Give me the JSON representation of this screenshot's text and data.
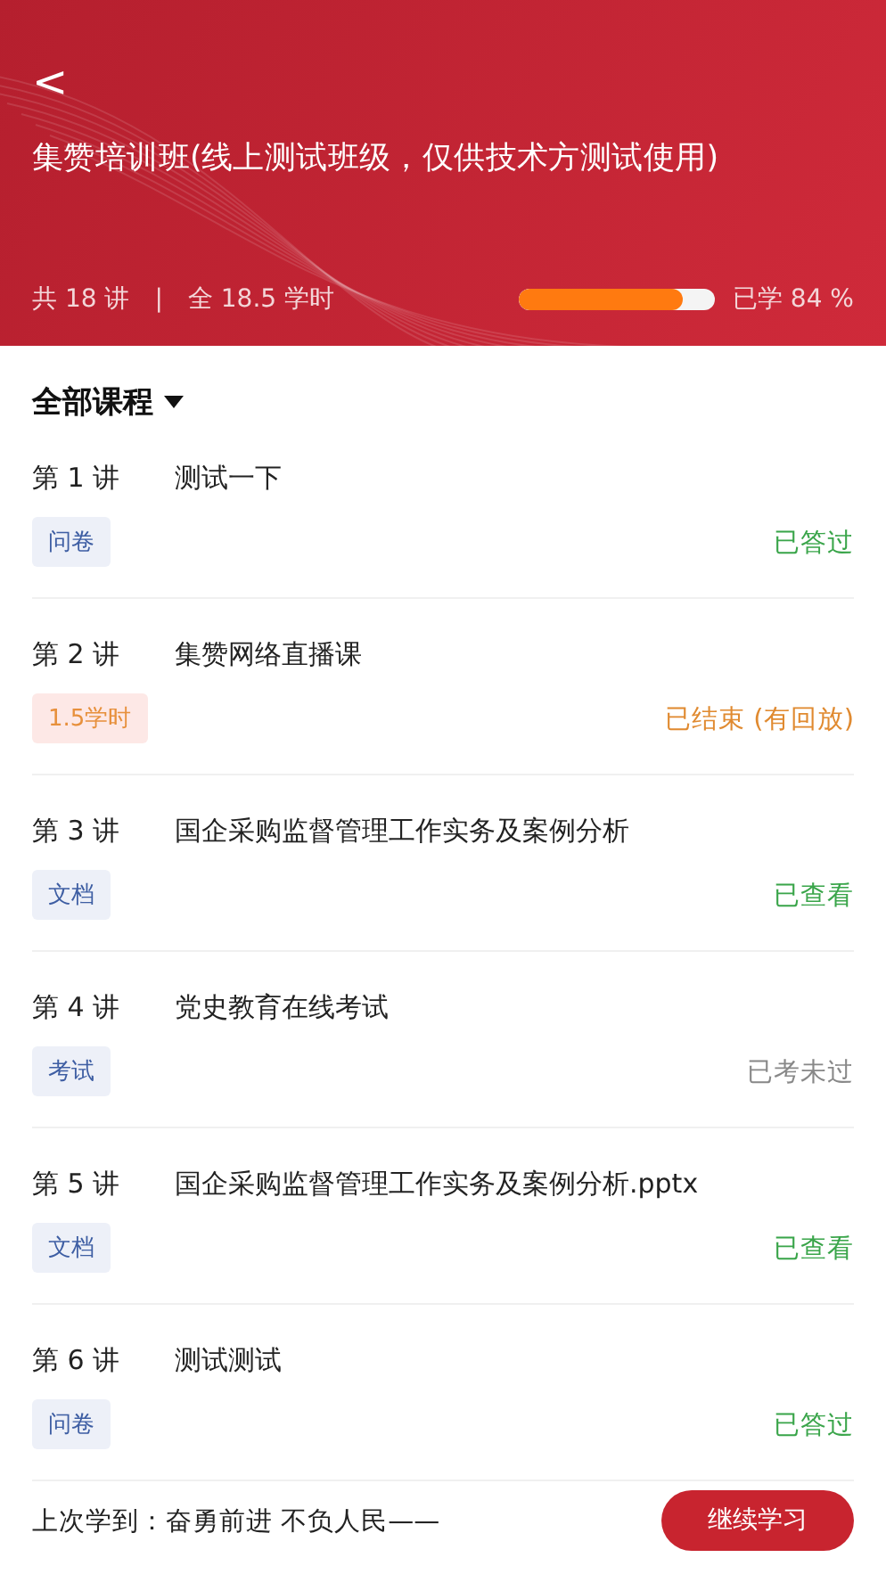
{
  "header": {
    "back": "<",
    "title": "集赞培训班(线上测试班级，仅供技术方测试使用)",
    "lectures": "共 18 讲",
    "separator": "|",
    "hours": "全 18.5 学时",
    "progress": {
      "level": 0.84,
      "label": "已学 84 %"
    }
  },
  "filter": {
    "label": "全部课程",
    "expanded": false
  },
  "lessons": [
    {
      "number": "第 1 讲",
      "title": "测试一下",
      "tag": {
        "text": "问卷",
        "kind": "type"
      },
      "status": {
        "text": "已答过",
        "kind": "done"
      }
    },
    {
      "number": "第 2 讲",
      "title": "集赞网络直播课",
      "tag": {
        "text": "1.5学时",
        "kind": "hours"
      },
      "status": {
        "text": "已结束 (有回放)",
        "kind": "ended"
      }
    },
    {
      "number": "第 3 讲",
      "title": "国企采购监督管理工作实务及案例分析",
      "tag": {
        "text": "文档",
        "kind": "type"
      },
      "status": {
        "text": "已查看",
        "kind": "done"
      }
    },
    {
      "number": "第 4 讲",
      "title": "党史教育在线考试",
      "tag": {
        "text": "考试",
        "kind": "type"
      },
      "status": {
        "text": "已考未过",
        "kind": "failed"
      }
    },
    {
      "number": "第 5 讲",
      "title": "国企采购监督管理工作实务及案例分析.pptx",
      "tag": {
        "text": "文档",
        "kind": "type"
      },
      "status": {
        "text": "已查看",
        "kind": "done"
      }
    },
    {
      "number": "第 6 讲",
      "title": "测试测试",
      "tag": {
        "text": "问卷",
        "kind": "type"
      },
      "status": {
        "text": "已答过",
        "kind": "done"
      }
    }
  ],
  "footer": {
    "last_studied": "上次学到：奋勇前进 不负人民——",
    "button": "继续学习"
  }
}
